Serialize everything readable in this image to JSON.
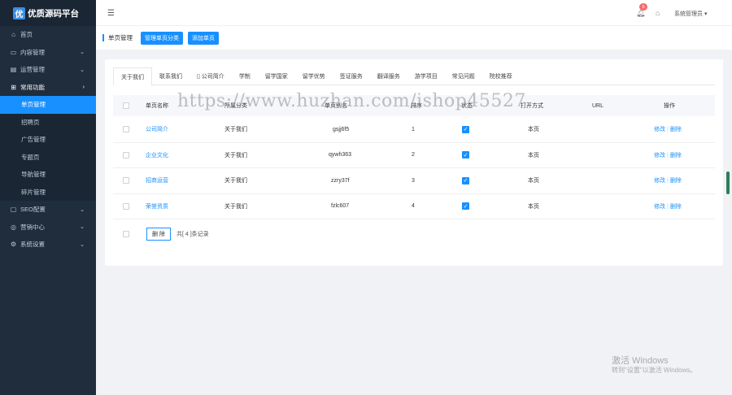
{
  "brand": {
    "mark": "优",
    "title": "优质源码平台"
  },
  "sidebar": {
    "items": [
      {
        "icon": "home-icon",
        "glyph": "⌂",
        "label": "首页",
        "arrow": ""
      },
      {
        "icon": "document-icon",
        "glyph": "▭",
        "label": "内容管理",
        "arrow": "⌄"
      },
      {
        "icon": "chart-icon",
        "glyph": "▤",
        "label": "运营管理",
        "arrow": "⌄"
      },
      {
        "icon": "grid-icon",
        "glyph": "⊞",
        "label": "常用功能",
        "arrow": "›"
      }
    ],
    "sub_items": [
      {
        "label": "单页管理",
        "active": true
      },
      {
        "label": "招聘页",
        "active": false
      },
      {
        "label": "广告管理",
        "active": false
      },
      {
        "label": "专题页",
        "active": false
      },
      {
        "label": "导航管理",
        "active": false
      },
      {
        "label": "碎片管理",
        "active": false
      }
    ],
    "items_after": [
      {
        "icon": "seo-icon",
        "glyph": "▢",
        "label": "SEO配置",
        "arrow": "⌄"
      },
      {
        "icon": "marketing-icon",
        "glyph": "◎",
        "label": "营销中心",
        "arrow": "⌄"
      },
      {
        "icon": "settings-icon",
        "glyph": "⚙",
        "label": "系统设置",
        "arrow": "⌄"
      }
    ]
  },
  "topbar": {
    "menu_icon": "☰",
    "notification_count": "5",
    "user_label": "系统管理员 ▾"
  },
  "toolbar": {
    "breadcrumb": "单页管理",
    "btn_manage_category": "管理单页分类",
    "btn_add_page": "添加单页"
  },
  "tabs": [
    "关于我们",
    "联系我们",
    "公司简介",
    "学制",
    "留学国家",
    "留学优势",
    "签证服务",
    "翻译服务",
    "游学项目",
    "常见问题",
    "院校推荐"
  ],
  "table": {
    "headers": {
      "name": "单页名称",
      "category": "所属分类",
      "alias": "单页别名",
      "order": "排序",
      "status": "状态",
      "open_mode": "打开方式",
      "url": "URL",
      "actions": "操作"
    },
    "rows": [
      {
        "name": "公司简介",
        "category": "关于我们",
        "alias": "gsjj6f5",
        "order": "1",
        "open_mode": "本页",
        "url": "",
        "edit": "修改",
        "delete": "删除"
      },
      {
        "name": "企业文化",
        "category": "关于我们",
        "alias": "qywh363",
        "order": "2",
        "open_mode": "本页",
        "url": "",
        "edit": "修改",
        "delete": "删除"
      },
      {
        "name": "招商运营",
        "category": "关于我们",
        "alias": "zzry37f",
        "order": "3",
        "open_mode": "本页",
        "url": "",
        "edit": "修改",
        "delete": "删除"
      },
      {
        "name": "荣誉资质",
        "category": "关于我们",
        "alias": "fzlc607",
        "order": "4",
        "open_mode": "本页",
        "url": "",
        "edit": "修改",
        "delete": "删除"
      }
    ]
  },
  "footer": {
    "delete_btn": "删 除",
    "count_text": "共[ 4 ]条记录"
  },
  "watermark": "https://www.huzhan.com/ishop45527",
  "activation": {
    "line1": "激活 Windows",
    "line2": "转到\"设置\"以激活 Windows。"
  }
}
